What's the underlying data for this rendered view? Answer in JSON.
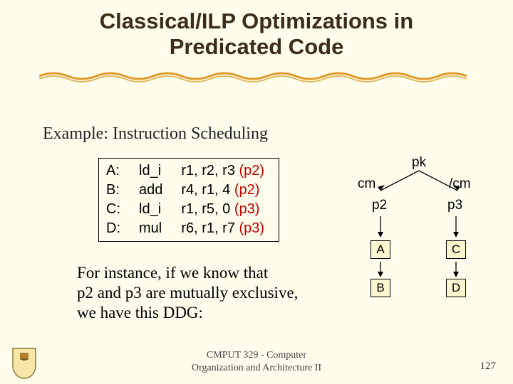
{
  "title_line1": "Classical/ILP Optimizations in",
  "title_line2": "Predicated Code",
  "subtitle": "Example: Instruction Scheduling",
  "code": {
    "rows": [
      {
        "label": "A:",
        "op": "ld_i",
        "args": "r1, r2, r3",
        "pred": "(p2)"
      },
      {
        "label": "B:",
        "op": "add",
        "args": "r4, r1, 4",
        "pred": "(p2)"
      },
      {
        "label": "C:",
        "op": "ld_i",
        "args": "r1, r5, 0",
        "pred": "(p3)"
      },
      {
        "label": "D:",
        "op": "mul",
        "args": "r6, r1, r7",
        "pred": "(p3)"
      }
    ]
  },
  "para_l1": "For instance, if we know that",
  "para_l2": "p2 and p3 are mutually exclusive,",
  "para_l3": "we have this DDG:",
  "ddg": {
    "root": "pk",
    "left_edge": "cm",
    "right_edge": "/cm",
    "left_pred": "p2",
    "right_pred": "p3",
    "boxes": [
      "A",
      "C",
      "B",
      "D"
    ]
  },
  "footer_l1": "CMPUT 329 - Computer",
  "footer_l2": "Organization and Architecture II",
  "pagenum": "127"
}
